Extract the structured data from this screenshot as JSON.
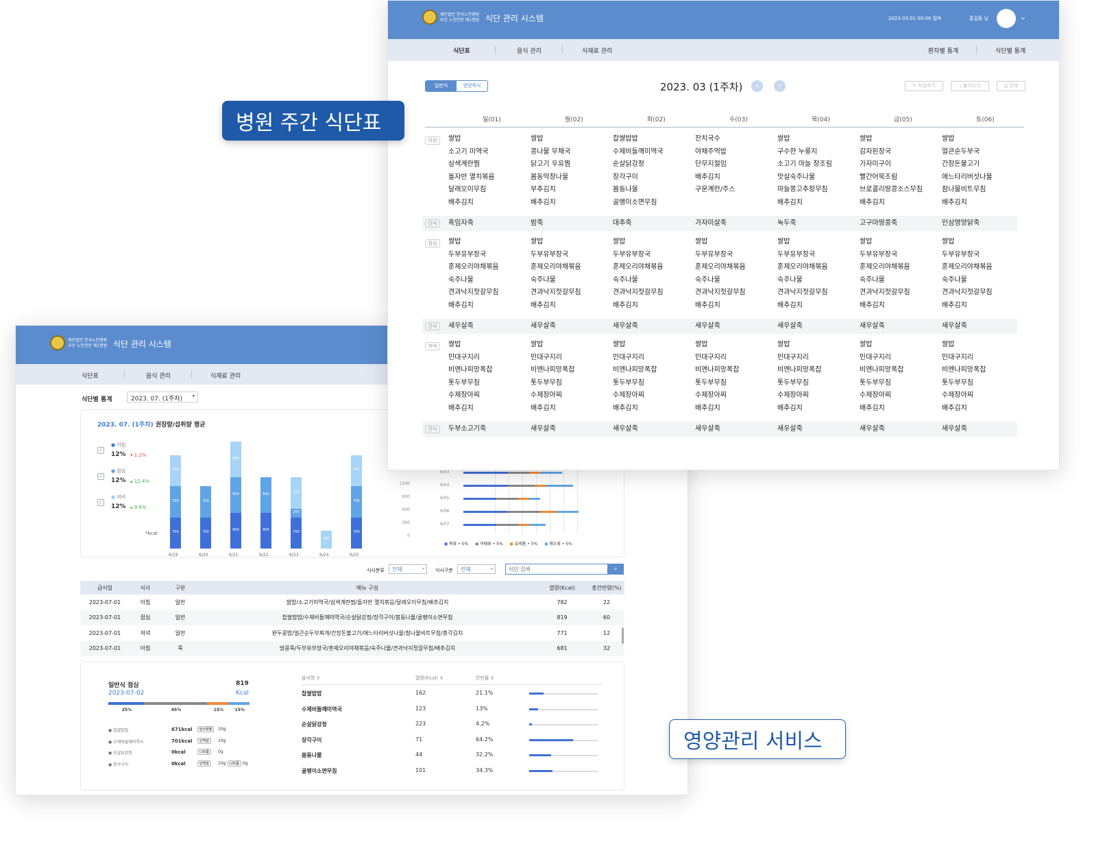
{
  "labels": {
    "weekly": "병원 주간 식단표",
    "service": "영양관리 서비스"
  },
  "header": {
    "org_line1": "재단법인 한국노인병원",
    "org_line2": "부산 노인전문 제1병원",
    "title": "식단 관리 시스템",
    "last_login": "2023.03.01  09:00 접속",
    "user": "홍길동 님"
  },
  "nav": {
    "items": [
      "식단표",
      "음식 관리",
      "식재료 관리"
    ],
    "right": [
      "환자별 통계",
      "식단별 통계"
    ]
  },
  "weekly": {
    "toggle": [
      "일반식",
      "영양죽식"
    ],
    "period": "2023. 03 (1주차)",
    "actions": [
      "작성하기",
      "불러오기",
      "인쇄"
    ],
    "days": [
      "일(01)",
      "월(02)",
      "화(02)",
      "수(03)",
      "목(04)",
      "금(05)",
      "토(06)"
    ],
    "meal_tags": [
      "아침",
      "간식",
      "점심",
      "간식",
      "저녁",
      "간식"
    ],
    "breakfast": [
      "쌀밥\n소고기 미역국\n삼색계란찜\n돌자반 멸치볶음\n달래오이무침\n배추김치",
      "쌀밥\n콩나물 무채국\n닭고기 우유찜\n봄동막장나물\n부추김치\n배추김치",
      "찹쌀밥밥\n수제비들깨미역국\n순살닭강정\n장각구이\n봄동나물\n골뱅이소면무침",
      "잔치국수\n야채주먹밥\n단무지절임\n배추김치\n구운계란/주스",
      "쌀밥\n구수한 누룽지\n소고기 마늘 장조림\n맛살숙주나물\n마늘쫑고추장무침\n배추김치",
      "쌀밥\n감자된장국\n가자미구이\n빨간어묵조림\n브로콜리땅콩소스무침\n배추김치",
      "쌀밥\n얼큰순두부국\n간장돈불고기\n애느타리버섯나물\n참나물비트무침\n배추김치"
    ],
    "snack1": [
      "흑임자죽",
      "밤죽",
      "대추죽",
      "가자미살죽",
      "녹두죽",
      "고구마땅콩죽",
      "인삼영양닭죽"
    ],
    "lunch": "쌀밥\n두부유부장국\n훈제오리야채볶음\n숙주나물\n견과낙지젓갈무침\n배추김치",
    "snack2": "새우살죽",
    "dinner": "쌀밥\n민대구지리\n비엔나피망폭찹\n톳두부무침\n수제장아찌\n배추김치",
    "snack3": [
      "두부소고기죽",
      "새우살죽",
      "새우살죽",
      "새우살죽",
      "새우살죽",
      "새우살죽",
      "새우살죽"
    ]
  },
  "stats": {
    "page_label": "식단별 통계",
    "select": "2023. 07. (1주차)",
    "chart_title_date": "2023. 07. (1주차)",
    "chart_title": " 권장량/섭취량 평균",
    "legend": [
      {
        "name": "아침",
        "pct": "12%",
        "delta": "▾ 1.2%"
      },
      {
        "name": "점심",
        "pct": "12%",
        "delta": "▴ 12.4%"
      },
      {
        "name": "저녁",
        "pct": "12%",
        "delta": "▴ 9.6%"
      }
    ],
    "unit": "*kcal",
    "filters": {
      "type_label": "식사분류",
      "type_value": "전체",
      "meal_label": "식사구분",
      "meal_value": "전체",
      "search_placeholder": "식단 검색"
    },
    "table": {
      "headers": [
        "급식일",
        "식사",
        "구분",
        "메뉴 구성",
        "열량(Kcal)",
        "총잔반량(%)"
      ],
      "rows": [
        [
          "2023-07-01",
          "아침",
          "일반",
          "쌀밥/소고기미역국/삼색계란찜/돌자반 멸치볶음/달래오이무침/배추김치",
          "782",
          "22"
        ],
        [
          "2023-07-01",
          "점심",
          "일반",
          "찹쌀밥밥/수제비들깨미역국/순살닭강정/장각구이/봄동나물/골뱅이소면무침",
          "819",
          "60"
        ],
        [
          "2023-07-01",
          "저녁",
          "일반",
          "완두콩밥/얼큰순두부찌개/간장돈불고기/애느타리버섯나물/참나물비트무침/총각김치",
          "771",
          "12"
        ],
        [
          "2023-07-01",
          "아침",
          "죽",
          "땅콩죽/두부유부장국/훈제오리야채볶음/숙주나물/견과낙지젓갈무침/배추김치",
          "681",
          "32"
        ]
      ]
    },
    "detail": {
      "title": "일반식 점심",
      "kcal": "819",
      "date": "2023-07-02",
      "kcal_unit": "Kcal",
      "ratios": [
        "25%",
        "45%",
        "15%",
        "15%"
      ],
      "items": [
        {
          "name": "찹쌀밥밥",
          "kcal": "671kcal",
          "tag1": "탄수화물",
          "v1": "10g",
          "tag2": "",
          "v2": ""
        },
        {
          "name": "수제비들깨미역국",
          "kcal": "701kcal",
          "tag1": "단백질",
          "v1": "10g",
          "tag2": "",
          "v2": ""
        },
        {
          "name": "순살닭강정",
          "kcal": "0kcal",
          "tag1": "나트륨",
          "v1": "0g",
          "tag2": "",
          "v2": ""
        },
        {
          "name": "장각구이",
          "kcal": "0kcal",
          "tag1": "단백질",
          "v1": "10g",
          "tag2": "나트륨",
          "v2": "0g"
        }
      ],
      "food_headers": [
        "음식명 ⇕",
        "열량(Kcal) ⇕",
        "잔반률 ⇕"
      ],
      "foods": [
        {
          "name": "찹쌀밥밥",
          "kcal": "162",
          "rate": "21.1%",
          "pct": 21.1
        },
        {
          "name": "수제비들깨미역국",
          "kcal": "123",
          "rate": "13%",
          "pct": 13
        },
        {
          "name": "순살닭강정",
          "kcal": "223",
          "rate": "4.2%",
          "pct": 4.2
        },
        {
          "name": "장각구이",
          "kcal": "71",
          "rate": "64.2%",
          "pct": 64.2
        },
        {
          "name": "봄동나물",
          "kcal": "44",
          "rate": "32.2%",
          "pct": 32.2
        },
        {
          "name": "골뱅이소면무침",
          "kcal": "101",
          "rate": "34.3%",
          "pct": 34.3
        }
      ],
      "hbar_legend": [
        "육류 • 5%",
        "어패류 • 5%",
        "유제품 • 5%",
        "채소류 • 5%"
      ]
    }
  },
  "chart_data": {
    "type": "bar",
    "categories": [
      "6/19",
      "6/20",
      "6/21",
      "6/22",
      "6/23",
      "6/24",
      "6/25"
    ],
    "series": [
      {
        "name": "아침",
        "values": [
          700,
          700,
          800,
          800,
          700,
          0,
          700
        ]
      },
      {
        "name": "점심",
        "values": [
          700,
          700,
          800,
          800,
          200,
          0,
          700
        ]
      },
      {
        "name": "저녁",
        "values": [
          700,
          0,
          800,
          0,
          700,
          400,
          700
        ]
      }
    ],
    "y_ticks": [
      "0",
      "300",
      "600",
      "900",
      "1200"
    ],
    "hbar_rows": [
      "6/03",
      "6/04",
      "6/05",
      "6/06",
      "6/07"
    ],
    "hbar_values": [
      [
        40,
        20,
        10,
        20
      ],
      [
        40,
        25,
        10,
        25
      ],
      [
        30,
        20,
        10,
        10
      ],
      [
        40,
        30,
        15,
        20
      ],
      [
        30,
        20,
        10,
        15
      ]
    ]
  }
}
